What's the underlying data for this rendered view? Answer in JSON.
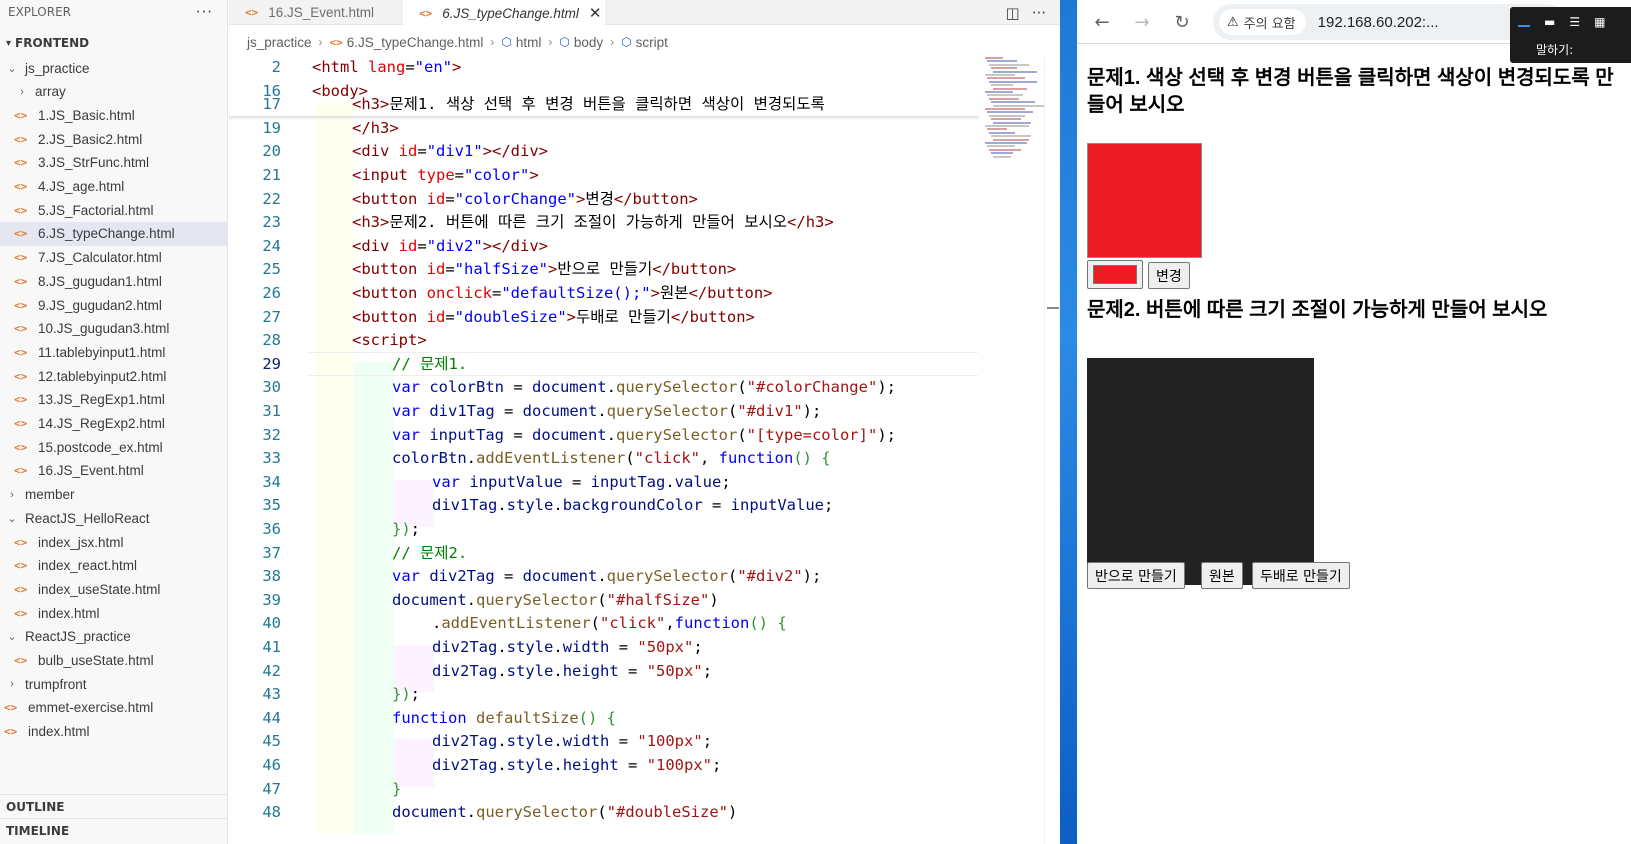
{
  "explorer": {
    "title": "EXPLORER",
    "root": "FRONTEND",
    "items": [
      {
        "label": "js_practice",
        "kind": "folder-open",
        "depth": 0
      },
      {
        "label": "array",
        "kind": "folder-closed",
        "depth": 1
      },
      {
        "label": "1.JS_Basic.html",
        "kind": "file",
        "depth": 1
      },
      {
        "label": "2.JS_Basic2.html",
        "kind": "file",
        "depth": 1
      },
      {
        "label": "3.JS_StrFunc.html",
        "kind": "file",
        "depth": 1
      },
      {
        "label": "4.JS_age.html",
        "kind": "file",
        "depth": 1
      },
      {
        "label": "5.JS_Factorial.html",
        "kind": "file",
        "depth": 1
      },
      {
        "label": "6.JS_typeChange.html",
        "kind": "file",
        "depth": 1,
        "selected": true
      },
      {
        "label": "7.JS_Calculator.html",
        "kind": "file",
        "depth": 1
      },
      {
        "label": "8.JS_gugudan1.html",
        "kind": "file",
        "depth": 1
      },
      {
        "label": "9.JS_gugudan2.html",
        "kind": "file",
        "depth": 1
      },
      {
        "label": "10.JS_gugudan3.html",
        "kind": "file",
        "depth": 1
      },
      {
        "label": "11.tablebyinput1.html",
        "kind": "file",
        "depth": 1
      },
      {
        "label": "12.tablebyinput2.html",
        "kind": "file",
        "depth": 1
      },
      {
        "label": "13.JS_RegExp1.html",
        "kind": "file",
        "depth": 1
      },
      {
        "label": "14.JS_RegExp2.html",
        "kind": "file",
        "depth": 1
      },
      {
        "label": "15.postcode_ex.html",
        "kind": "file",
        "depth": 1
      },
      {
        "label": "16.JS_Event.html",
        "kind": "file",
        "depth": 1
      },
      {
        "label": "member",
        "kind": "folder-closed",
        "depth": 0
      },
      {
        "label": "ReactJS_HelloReact",
        "kind": "folder-open",
        "depth": 0
      },
      {
        "label": "index_jsx.html",
        "kind": "file",
        "depth": 1
      },
      {
        "label": "index_react.html",
        "kind": "file",
        "depth": 1
      },
      {
        "label": "index_useState.html",
        "kind": "file",
        "depth": 1
      },
      {
        "label": "index.html",
        "kind": "file",
        "depth": 1
      },
      {
        "label": "ReactJS_practice",
        "kind": "folder-open",
        "depth": 0
      },
      {
        "label": "bulb_useState.html",
        "kind": "file",
        "depth": 1
      },
      {
        "label": "trumpfront",
        "kind": "folder-closed",
        "depth": 0
      },
      {
        "label": "emmet-exercise.html",
        "kind": "file",
        "depth": 0
      },
      {
        "label": "index.html",
        "kind": "file",
        "depth": 0
      }
    ],
    "outline": "OUTLINE",
    "timeline": "TIMELINE"
  },
  "editor": {
    "tabs": [
      {
        "label": "16.JS_Event.html",
        "active": false
      },
      {
        "label": "6.JS_typeChange.html",
        "active": true
      }
    ],
    "breadcrumb": [
      "js_practice",
      "6.JS_typeChange.html",
      "html",
      "body",
      "script"
    ],
    "current_line": "29",
    "lines": [
      {
        "n": "2",
        "indent": 0,
        "tokens": [
          [
            "tag",
            "<html "
          ],
          [
            "attr",
            "lang"
          ],
          [
            "",
            "="
          ],
          [
            "str",
            "\"en\""
          ],
          [
            "tag",
            ">"
          ]
        ]
      },
      {
        "n": "16",
        "indent": 0,
        "tokens": [
          [
            "tag",
            "<body>"
          ]
        ]
      },
      {
        "n": "17",
        "indent": 1,
        "tokens": [
          [
            "tag",
            "<h3>"
          ],
          [
            "",
            "문제1. 색상 선택 후 변경 버튼을 클릭하면 색상이 변경되도록"
          ]
        ]
      },
      {
        "n": "19",
        "indent": 1,
        "tokens": [
          [
            "tag",
            "</h3>"
          ]
        ]
      },
      {
        "n": "20",
        "indent": 1,
        "tokens": [
          [
            "tag",
            "<div "
          ],
          [
            "attr",
            "id"
          ],
          [
            "",
            "="
          ],
          [
            "str",
            "\"div1\""
          ],
          [
            "tag",
            "></div>"
          ]
        ]
      },
      {
        "n": "21",
        "indent": 1,
        "tokens": [
          [
            "tag",
            "<input "
          ],
          [
            "attr",
            "type"
          ],
          [
            "",
            "="
          ],
          [
            "str",
            "\"color\""
          ],
          [
            "tag",
            ">"
          ]
        ]
      },
      {
        "n": "22",
        "indent": 1,
        "tokens": [
          [
            "tag",
            "<button "
          ],
          [
            "attr",
            "id"
          ],
          [
            "",
            "="
          ],
          [
            "str",
            "\"colorChange\""
          ],
          [
            "tag",
            ">"
          ],
          [
            "",
            "변경"
          ],
          [
            "tag",
            "</button>"
          ]
        ]
      },
      {
        "n": "23",
        "indent": 1,
        "tokens": [
          [
            "tag",
            "<h3>"
          ],
          [
            "",
            "문제2. 버튼에 따른 크기 조절이 가능하게 만들어 보시오"
          ],
          [
            "tag",
            "</h3>"
          ]
        ]
      },
      {
        "n": "24",
        "indent": 1,
        "tokens": [
          [
            "tag",
            "<div "
          ],
          [
            "attr",
            "id"
          ],
          [
            "",
            "="
          ],
          [
            "str",
            "\"div2\""
          ],
          [
            "tag",
            "></div>"
          ]
        ]
      },
      {
        "n": "25",
        "indent": 1,
        "tokens": [
          [
            "tag",
            "<button "
          ],
          [
            "attr",
            "id"
          ],
          [
            "",
            "="
          ],
          [
            "str",
            "\"halfSize\""
          ],
          [
            "tag",
            ">"
          ],
          [
            "",
            "반으로 만들기"
          ],
          [
            "tag",
            "</button>"
          ]
        ]
      },
      {
        "n": "26",
        "indent": 1,
        "tokens": [
          [
            "tag",
            "<button "
          ],
          [
            "attr",
            "onclick"
          ],
          [
            "",
            "="
          ],
          [
            "str",
            "\"defaultSize();\""
          ],
          [
            "tag",
            ">"
          ],
          [
            "",
            "원본"
          ],
          [
            "tag",
            "</button>"
          ]
        ]
      },
      {
        "n": "27",
        "indent": 1,
        "tokens": [
          [
            "tag",
            "<button "
          ],
          [
            "attr",
            "id"
          ],
          [
            "",
            "="
          ],
          [
            "str",
            "\"doubleSize\""
          ],
          [
            "tag",
            ">"
          ],
          [
            "",
            "두배로 만들기"
          ],
          [
            "tag",
            "</button>"
          ]
        ]
      },
      {
        "n": "28",
        "indent": 1,
        "tokens": [
          [
            "tag",
            "<script>"
          ]
        ]
      },
      {
        "n": "29",
        "indent": 2,
        "tokens": [
          [
            "cm",
            "// 문제1."
          ]
        ]
      },
      {
        "n": "30",
        "indent": 2,
        "tokens": [
          [
            "kw",
            "var "
          ],
          [
            "var",
            "colorBtn"
          ],
          [
            "",
            " = "
          ],
          [
            "var",
            "document"
          ],
          [
            "",
            "."
          ],
          [
            "fn",
            "querySelector"
          ],
          [
            "",
            "("
          ],
          [
            "jsstr",
            "\"#colorChange\""
          ],
          [
            "",
            ");"
          ]
        ]
      },
      {
        "n": "31",
        "indent": 2,
        "tokens": [
          [
            "kw",
            "var "
          ],
          [
            "var",
            "div1Tag"
          ],
          [
            "",
            " = "
          ],
          [
            "var",
            "document"
          ],
          [
            "",
            "."
          ],
          [
            "fn",
            "querySelector"
          ],
          [
            "",
            "("
          ],
          [
            "jsstr",
            "\"#div1\""
          ],
          [
            "",
            ");"
          ]
        ]
      },
      {
        "n": "32",
        "indent": 2,
        "tokens": [
          [
            "kw",
            "var "
          ],
          [
            "var",
            "inputTag"
          ],
          [
            "",
            " = "
          ],
          [
            "var",
            "document"
          ],
          [
            "",
            "."
          ],
          [
            "fn",
            "querySelector"
          ],
          [
            "",
            "("
          ],
          [
            "jsstr",
            "\"[type=color]\""
          ],
          [
            "",
            ");"
          ]
        ]
      },
      {
        "n": "33",
        "indent": 2,
        "tokens": [
          [
            "var",
            "colorBtn"
          ],
          [
            "",
            "."
          ],
          [
            "fn",
            "addEventListener"
          ],
          [
            "",
            "("
          ],
          [
            "jsstr",
            "\"click\""
          ],
          [
            "",
            ", "
          ],
          [
            "kw",
            "function"
          ],
          [
            "br2",
            "() {"
          ]
        ]
      },
      {
        "n": "34",
        "indent": 3,
        "tokens": [
          [
            "kw",
            "var "
          ],
          [
            "var",
            "inputValue"
          ],
          [
            "",
            " = "
          ],
          [
            "var",
            "inputTag"
          ],
          [
            "",
            "."
          ],
          [
            "var",
            "value"
          ],
          [
            "",
            ";"
          ]
        ]
      },
      {
        "n": "35",
        "indent": 3,
        "tokens": [
          [
            "var",
            "div1Tag"
          ],
          [
            "",
            "."
          ],
          [
            "var",
            "style"
          ],
          [
            "",
            "."
          ],
          [
            "var",
            "backgroundColor"
          ],
          [
            "",
            " = "
          ],
          [
            "var",
            "inputValue"
          ],
          [
            "",
            ";"
          ]
        ]
      },
      {
        "n": "36",
        "indent": 2,
        "tokens": [
          [
            "br2",
            "})"
          ],
          [
            "",
            ";"
          ]
        ]
      },
      {
        "n": "37",
        "indent": 2,
        "tokens": [
          [
            "cm",
            "// 문제2."
          ]
        ]
      },
      {
        "n": "38",
        "indent": 2,
        "tokens": [
          [
            "kw",
            "var "
          ],
          [
            "var",
            "div2Tag"
          ],
          [
            "",
            " = "
          ],
          [
            "var",
            "document"
          ],
          [
            "",
            "."
          ],
          [
            "fn",
            "querySelector"
          ],
          [
            "",
            "("
          ],
          [
            "jsstr",
            "\"#div2\""
          ],
          [
            "",
            ");"
          ]
        ]
      },
      {
        "n": "39",
        "indent": 2,
        "tokens": [
          [
            "var",
            "document"
          ],
          [
            "",
            "."
          ],
          [
            "fn",
            "querySelector"
          ],
          [
            "",
            "("
          ],
          [
            "jsstr",
            "\"#halfSize\""
          ],
          [
            "",
            ")"
          ]
        ]
      },
      {
        "n": "40",
        "indent": 3,
        "tokens": [
          [
            "",
            "."
          ],
          [
            "fn",
            "addEventListener"
          ],
          [
            "",
            "("
          ],
          [
            "jsstr",
            "\"click\""
          ],
          [
            "",
            ","
          ],
          [
            "kw",
            "function"
          ],
          [
            "br2",
            "() {"
          ]
        ]
      },
      {
        "n": "41",
        "indent": 3,
        "tokens": [
          [
            "var",
            "div2Tag"
          ],
          [
            "",
            "."
          ],
          [
            "var",
            "style"
          ],
          [
            "",
            "."
          ],
          [
            "var",
            "width"
          ],
          [
            "",
            " = "
          ],
          [
            "jsstr",
            "\"50px\""
          ],
          [
            "",
            ";"
          ]
        ]
      },
      {
        "n": "42",
        "indent": 3,
        "tokens": [
          [
            "var",
            "div2Tag"
          ],
          [
            "",
            "."
          ],
          [
            "var",
            "style"
          ],
          [
            "",
            "."
          ],
          [
            "var",
            "height"
          ],
          [
            "",
            " = "
          ],
          [
            "jsstr",
            "\"50px\""
          ],
          [
            "",
            ";"
          ]
        ]
      },
      {
        "n": "43",
        "indent": 2,
        "tokens": [
          [
            "br2",
            "})"
          ],
          [
            "",
            ";"
          ]
        ]
      },
      {
        "n": "44",
        "indent": 2,
        "tokens": [
          [
            "kw",
            "function "
          ],
          [
            "fn",
            "defaultSize"
          ],
          [
            "br2",
            "() {"
          ]
        ]
      },
      {
        "n": "45",
        "indent": 3,
        "tokens": [
          [
            "var",
            "div2Tag"
          ],
          [
            "",
            "."
          ],
          [
            "var",
            "style"
          ],
          [
            "",
            "."
          ],
          [
            "var",
            "width"
          ],
          [
            "",
            " = "
          ],
          [
            "jsstr",
            "\"100px\""
          ],
          [
            "",
            ";"
          ]
        ]
      },
      {
        "n": "46",
        "indent": 3,
        "tokens": [
          [
            "var",
            "div2Tag"
          ],
          [
            "",
            "."
          ],
          [
            "var",
            "style"
          ],
          [
            "",
            "."
          ],
          [
            "var",
            "height"
          ],
          [
            "",
            " = "
          ],
          [
            "jsstr",
            "\"100px\""
          ],
          [
            "",
            ";"
          ]
        ]
      },
      {
        "n": "47",
        "indent": 2,
        "tokens": [
          [
            "br2",
            "}"
          ]
        ]
      },
      {
        "n": "48",
        "indent": 2,
        "tokens": [
          [
            "var",
            "document"
          ],
          [
            "",
            "."
          ],
          [
            "fn",
            "querySelector"
          ],
          [
            "",
            "("
          ],
          [
            "jsstr",
            "\"#doubleSize\""
          ],
          [
            "",
            ")"
          ]
        ]
      }
    ]
  },
  "browser": {
    "security_label": "주의 요함",
    "url": "192.168.60.202:...",
    "voice_label": "말하기:",
    "page": {
      "h3_1": "문제1. 색상 선택 후 변경 버튼을 클릭하면 색상이 변경되도록 만들어 보시오",
      "change_button": "변경",
      "h3_2": "문제2. 버튼에 따른 크기 조절이 가능하게 만들어 보시오",
      "half_button": "반으로 만들기",
      "default_button": "원본",
      "double_button": "두배로 만들기",
      "div1_color": "#ed1c24",
      "picked_color": "#ed1c24",
      "div2_color": "#222222"
    }
  }
}
